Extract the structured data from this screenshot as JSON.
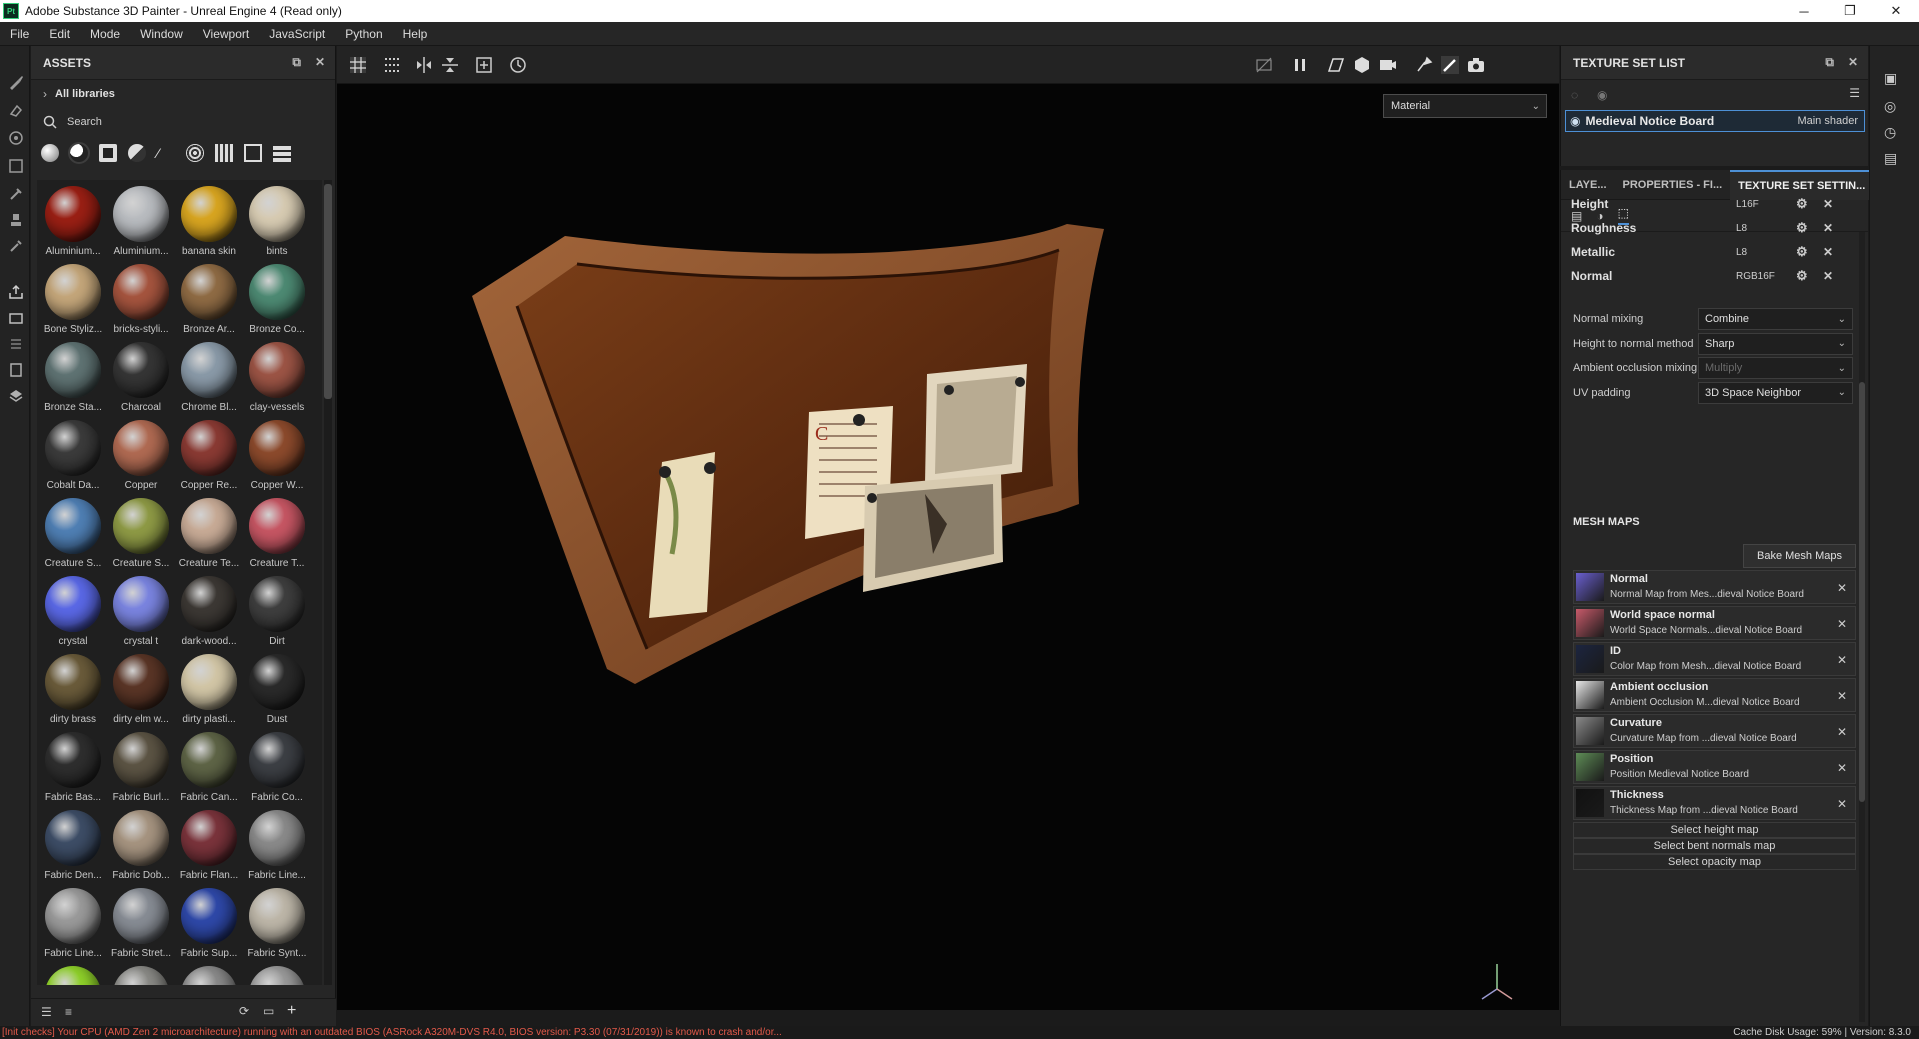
{
  "window": {
    "title": "Adobe Substance 3D Painter - Unreal Engine 4 (Read only)",
    "logo": "Pt",
    "controls": [
      "─",
      "❐",
      "✕"
    ]
  },
  "menu": [
    "File",
    "Edit",
    "Mode",
    "Window",
    "Viewport",
    "JavaScript",
    "Python",
    "Help"
  ],
  "assets": {
    "title": "ASSETS",
    "library": "All libraries",
    "search_placeholder": "Search",
    "items": [
      {
        "label": "Aluminium...",
        "color": "#9a1f14"
      },
      {
        "label": "Aluminium...",
        "color": "#b9bcc0"
      },
      {
        "label": "banana skin",
        "color": "#d8a520"
      },
      {
        "label": "bints",
        "color": "#d7cbb2"
      },
      {
        "label": "Bone Styliz...",
        "color": "#c4a67a"
      },
      {
        "label": "bricks-styli...",
        "color": "#a5543e"
      },
      {
        "label": "Bronze Ar...",
        "color": "#8f6b44"
      },
      {
        "label": "Bronze Co...",
        "color": "#4d8a73"
      },
      {
        "label": "Bronze Sta...",
        "color": "#5f7373"
      },
      {
        "label": "Charcoal",
        "color": "#353535"
      },
      {
        "label": "Chrome Bl...",
        "color": "#8a9aa8"
      },
      {
        "label": "clay-vessels",
        "color": "#9c5445"
      },
      {
        "label": "Cobalt Da...",
        "color": "#3b3b3b"
      },
      {
        "label": "Copper",
        "color": "#b06a52"
      },
      {
        "label": "Copper Re...",
        "color": "#8a3a33"
      },
      {
        "label": "Copper W...",
        "color": "#8c4a2c"
      },
      {
        "label": "Creature S...",
        "color": "#4f7fb4"
      },
      {
        "label": "Creature S...",
        "color": "#8e9a45"
      },
      {
        "label": "Creature Te...",
        "color": "#c8ab96"
      },
      {
        "label": "Creature T...",
        "color": "#c65663"
      },
      {
        "label": "crystal",
        "color": "#5a68e6"
      },
      {
        "label": "crystal t",
        "color": "#7a84e0"
      },
      {
        "label": "dark-wood...",
        "color": "#3c3834"
      },
      {
        "label": "Dirt",
        "color": "#3e3e3e"
      },
      {
        "label": "dirty brass",
        "color": "#6a5b3a"
      },
      {
        "label": "dirty elm w...",
        "color": "#5a3526"
      },
      {
        "label": "dirty plasti...",
        "color": "#d2c6a6"
      },
      {
        "label": "Dust",
        "color": "#2a2a2a"
      },
      {
        "label": "Fabric Bas...",
        "color": "#2e2e2e"
      },
      {
        "label": "Fabric Burl...",
        "color": "#5c5444"
      },
      {
        "label": "Fabric Can...",
        "color": "#5e6446"
      },
      {
        "label": "Fabric Co...",
        "color": "#3c3f44"
      },
      {
        "label": "Fabric Den...",
        "color": "#3d4d66"
      },
      {
        "label": "Fabric Dob...",
        "color": "#a69480"
      },
      {
        "label": "Fabric Flan...",
        "color": "#7a333b"
      },
      {
        "label": "Fabric Line...",
        "color": "#8a8a8a"
      },
      {
        "label": "Fabric Line...",
        "color": "#9a9a9a"
      },
      {
        "label": "Fabric Stret...",
        "color": "#878c94"
      },
      {
        "label": "Fabric Sup...",
        "color": "#2e48a8"
      },
      {
        "label": "Fabric Synt...",
        "color": "#bdb6a8"
      },
      {
        "label": "",
        "color": "#8fd12a"
      },
      {
        "label": "",
        "color": "#8a8a86"
      },
      {
        "label": "",
        "color": "#8a8a8a"
      },
      {
        "label": "",
        "color": "#9a9a9a"
      }
    ]
  },
  "viewport": {
    "material_mode": "Material"
  },
  "texture_set_list": {
    "title": "TEXTURE SET LIST",
    "item_name": "Medieval Notice Board",
    "item_shader": "Main shader"
  },
  "texture_set_settings": {
    "tabs": [
      "LAYE...",
      "PROPERTIES - FI...",
      "TEXTURE SET SETTIN..."
    ],
    "channels": [
      {
        "name": "Height",
        "format": "L16F"
      },
      {
        "name": "Roughness",
        "format": "L8"
      },
      {
        "name": "Metallic",
        "format": "L8"
      },
      {
        "name": "Normal",
        "format": "RGB16F"
      }
    ],
    "properties": [
      {
        "label": "Normal mixing",
        "value": "Combine",
        "disabled": false
      },
      {
        "label": "Height to normal method",
        "value": "Sharp",
        "disabled": false
      },
      {
        "label": "Ambient occlusion mixing",
        "value": "Multiply",
        "disabled": true
      },
      {
        "label": "UV padding",
        "value": "3D Space Neighbor",
        "disabled": false
      }
    ],
    "mesh_maps_title": "MESH MAPS",
    "bake_button": "Bake Mesh Maps",
    "mesh_maps": [
      {
        "name": "Normal",
        "desc": "Normal Map from Mes...dieval Notice Board",
        "thumb": "#6a5fcf"
      },
      {
        "name": "World space normal",
        "desc": "World Space Normals...dieval Notice Board",
        "thumb": "#c85a6a"
      },
      {
        "name": "ID",
        "desc": "Color Map from Mesh...dieval Notice Board",
        "thumb": "#1c2540"
      },
      {
        "name": "Ambient occlusion",
        "desc": "Ambient Occlusion M...dieval Notice Board",
        "thumb": "#e8e8e8"
      },
      {
        "name": "Curvature",
        "desc": "Curvature Map from ...dieval Notice Board",
        "thumb": "#8a8a8a"
      },
      {
        "name": "Position",
        "desc": "Position Medieval Notice Board",
        "thumb": "#5e8c56"
      },
      {
        "name": "Thickness",
        "desc": "Thickness Map from ...dieval Notice Board",
        "thumb": "#111111"
      }
    ],
    "select_maps": [
      "Select height map",
      "Select bent normals map",
      "Select opacity map"
    ]
  },
  "status": {
    "warning": "[Init checks] Your CPU (AMD Zen 2 microarchitecture) running with an outdated BIOS (ASRock A320M-DVS R4.0, BIOS version: P3.30 (07/31/2019)) is known to crash and/or...",
    "right": "Cache Disk Usage:  59% | Version: 8.3.0"
  },
  "colors": {
    "accent": "#4d90d6",
    "warning": "#e35a4a",
    "wood": "#6b3414"
  }
}
